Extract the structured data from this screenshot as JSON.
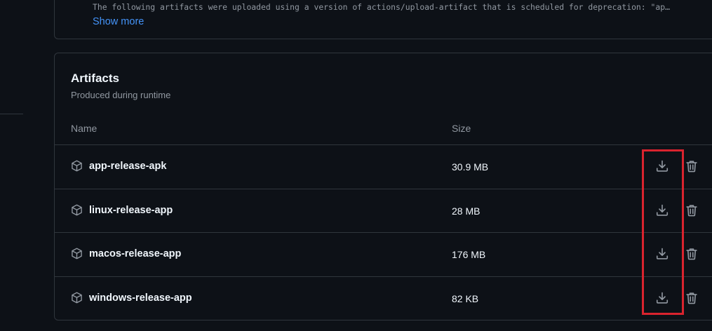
{
  "notice": {
    "text": "The following artifacts were uploaded using a version of actions/upload-artifact that is scheduled for deprecation: \"ap…",
    "show_more_label": "Show more"
  },
  "artifacts": {
    "title": "Artifacts",
    "subtitle": "Produced during runtime",
    "columns": {
      "name": "Name",
      "size": "Size"
    },
    "rows": [
      {
        "name": "app-release-apk",
        "size": "30.9 MB"
      },
      {
        "name": "linux-release-app",
        "size": "28 MB"
      },
      {
        "name": "macos-release-app",
        "size": "176 MB"
      },
      {
        "name": "windows-release-app",
        "size": "82 KB"
      }
    ]
  },
  "icons": {
    "package": "package-icon",
    "download": "download-icon",
    "delete": "trash-icon"
  },
  "colors": {
    "background": "#0d1117",
    "border": "#30363d",
    "link": "#4493f8",
    "muted_text": "#9198a1",
    "highlight": "#d9232e"
  }
}
